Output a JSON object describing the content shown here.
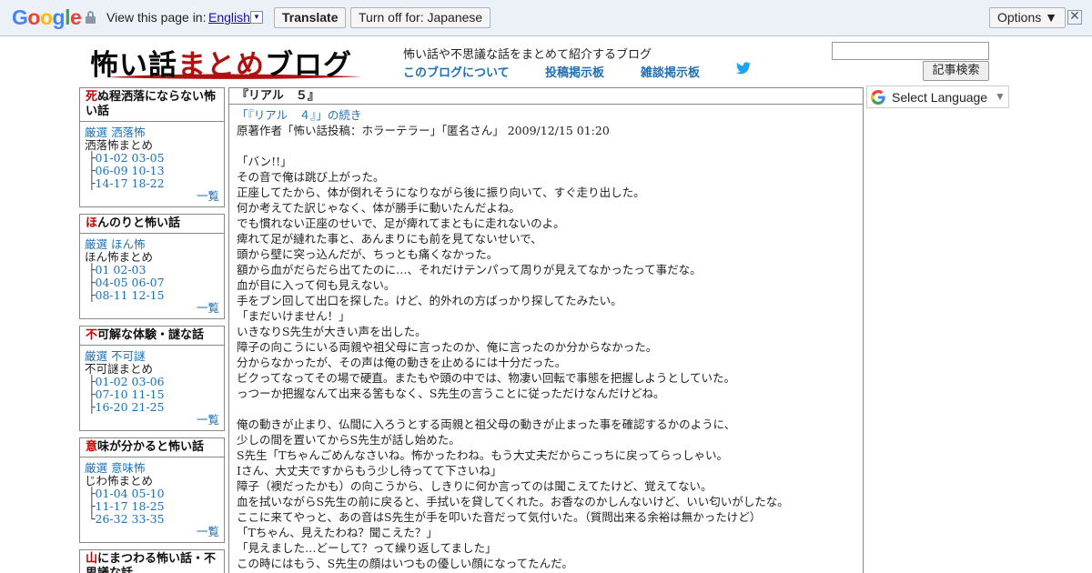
{
  "translate_bar": {
    "logo": "Google",
    "view_text": "View this page in:",
    "language": "English",
    "translate_button": "Translate",
    "turnoff_button": "Turn off for: Japanese",
    "options_button": "Options ▼",
    "close_glyph": "✕"
  },
  "header": {
    "logo_text_1": "怖い話",
    "logo_text_2": "まとめ",
    "logo_text_3": "ブログ",
    "tagline": "怖い話や不思議な話をまとめて紹介するブログ",
    "nav": [
      "このブログについて",
      "投稿掲示板",
      "雑談掲示板"
    ],
    "search_button": "記事検索",
    "search_value": ""
  },
  "sidebar": [
    {
      "title_red": "死",
      "title_rest": "ぬ程洒落にならない怖い話",
      "link_1": "厳選 洒落怖",
      "plain": "洒落怖まとめ",
      "ranges": [
        {
          "tree": "├",
          "text": "01-02 03-05"
        },
        {
          "tree": "├",
          "text": "06-09 10-13"
        },
        {
          "tree": "├",
          "text": "14-17 18-22"
        }
      ],
      "more": "一覧"
    },
    {
      "title_red": "ほ",
      "title_rest": "んのりと怖い話",
      "link_1": "厳選 ほん怖",
      "plain": "ほん怖まとめ",
      "ranges": [
        {
          "tree": "├",
          "text": "01 02-03"
        },
        {
          "tree": "├",
          "text": "04-05 06-07"
        },
        {
          "tree": "├",
          "text": "08-11 12-15"
        }
      ],
      "more": "一覧"
    },
    {
      "title_red": "不",
      "title_rest": "可解な体験・謎な話",
      "link_1": "厳選 不可謎",
      "plain": "不可謎まとめ",
      "ranges": [
        {
          "tree": "├",
          "text": "01-02 03-06"
        },
        {
          "tree": "├",
          "text": "07-10 11-15"
        },
        {
          "tree": "├",
          "text": "16-20 21-25"
        }
      ],
      "more": "一覧"
    },
    {
      "title_red": "意",
      "title_rest": "味が分かると怖い話",
      "link_1": "厳選 意味怖",
      "plain": "じわ怖まとめ",
      "ranges": [
        {
          "tree": "├",
          "text": "01-04 05-10"
        },
        {
          "tree": "├",
          "text": "11-17 18-25"
        },
        {
          "tree": "└",
          "text": "26-32 33-35"
        }
      ],
      "more": "一覧"
    },
    {
      "title_red": "山",
      "title_rest": "にまつわる怖い話・不思議な話"
    }
  ],
  "article": {
    "title": "『リアル　５』",
    "continued_link": "「『リアル　４』」の続き",
    "meta": "原著作者「怖い話投稿：ホラーテラー」「匿名さん」 2009/12/15 01:20",
    "lines": [
      "",
      "「バン!!」",
      "その音で俺は跳び上がった。",
      "正座してたから、体が倒れそうになりながら後に振り向いて、すぐ走り出した。",
      "何か考えてた訳じゃなく、体が勝手に動いたんだよね。",
      "でも慣れない正座のせいで、足が痺れてまともに走れないのよ。",
      "痺れて足が縺れた事と、あんまりにも前を見てないせいで、",
      "頭から壁に突っ込んだが、ちっとも痛くなかった。",
      "額から血がだらだら出てたのに…、それだけテンパって周りが見えてなかったって事だな。",
      "血が目に入って何も見えない。",
      "手をブン回して出口を探した。けど、的外れの方ばっかり探してたみたい。",
      "「まだいけません！」",
      "いきなりS先生が大きい声を出した。",
      "障子の向こうにいる両親や祖父母に言ったのか、俺に言ったのか分からなかった。",
      "分からなかったが、その声は俺の動きを止めるには十分だった。",
      "ビクってなってその場で硬直。またもや頭の中では、物凄い回転で事態を把握しようとしていた。",
      "っつーか把握なんて出来る筈もなく、S先生の言うことに従っただけなんだけどね。",
      "",
      "俺の動きが止まり、仏間に入ろうとする両親と祖父母の動きが止まった事を確認するかのように、",
      "少しの間を置いてからS先生が話し始めた。",
      "S先生「Tちゃんごめんなさいね。怖かったわね。もう大丈夫だからこっちに戻ってらっしゃい。",
      "Iさん、大丈夫ですからもう少し待ってて下さいね」",
      "障子（襖だったかも）の向こうから、しきりに何か言ってのは聞こえてたけど、覚えてない。",
      "血を拭いながらS先生の前に戻ると、手拭いを貸してくれた。お香なのかしんないけど、いい匂いがしたな。",
      "ここに来てやっと、あの音はS先生が手を叩いた音だって気付いた。（質問出来る余裕は無かったけど）",
      "「Tちゃん、見えたわね？聞こえた？」",
      "「見えました…どーして？って繰り返してました」",
      "この時にはもう、S先生の顔はいつもの優しい顔になってたんだ。"
    ]
  },
  "language_select": {
    "label": "Select Language",
    "arrow": "▼"
  },
  "colors": {
    "translate_bar_bg": "#ecf1f8",
    "link": "#1f6fb4",
    "accent_red": "#cc0000"
  }
}
